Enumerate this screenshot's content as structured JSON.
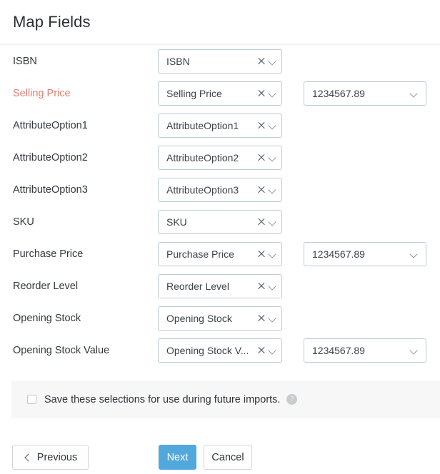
{
  "header": {
    "title": "Map Fields"
  },
  "fields": {
    "rows": [
      {
        "label": "ISBN",
        "required": false,
        "mapped": "ISBN",
        "format": null
      },
      {
        "label": "Selling Price",
        "required": true,
        "mapped": "Selling Price",
        "format": "1234567.89"
      },
      {
        "label": "AttributeOption1",
        "required": false,
        "mapped": "AttributeOption1",
        "format": null
      },
      {
        "label": "AttributeOption2",
        "required": false,
        "mapped": "AttributeOption2",
        "format": null
      },
      {
        "label": "AttributeOption3",
        "required": false,
        "mapped": "AttributeOption3",
        "format": null
      },
      {
        "label": "SKU",
        "required": false,
        "mapped": "SKU",
        "format": null
      },
      {
        "label": "Purchase Price",
        "required": false,
        "mapped": "Purchase Price",
        "format": "1234567.89"
      },
      {
        "label": "Reorder Level",
        "required": false,
        "mapped": "Reorder Level",
        "format": null
      },
      {
        "label": "Opening Stock",
        "required": false,
        "mapped": "Opening Stock",
        "format": null
      },
      {
        "label": "Opening Stock Value",
        "required": false,
        "mapped": "Opening Stock V...",
        "format": "1234567.89"
      }
    ],
    "clear_icon": "close-icon",
    "dropdown_icon": "chevron-down-icon"
  },
  "save_bar": {
    "checkbox_checked": false,
    "label": "Save these selections for use during future imports.",
    "help_icon": "?"
  },
  "footer": {
    "previous_label": "Previous",
    "next_label": "Next",
    "cancel_label": "Cancel"
  },
  "colors": {
    "accent": "#51a8dd",
    "required": "#de7f72",
    "border": "#bacbd9",
    "panel": "#f7f7f7"
  }
}
